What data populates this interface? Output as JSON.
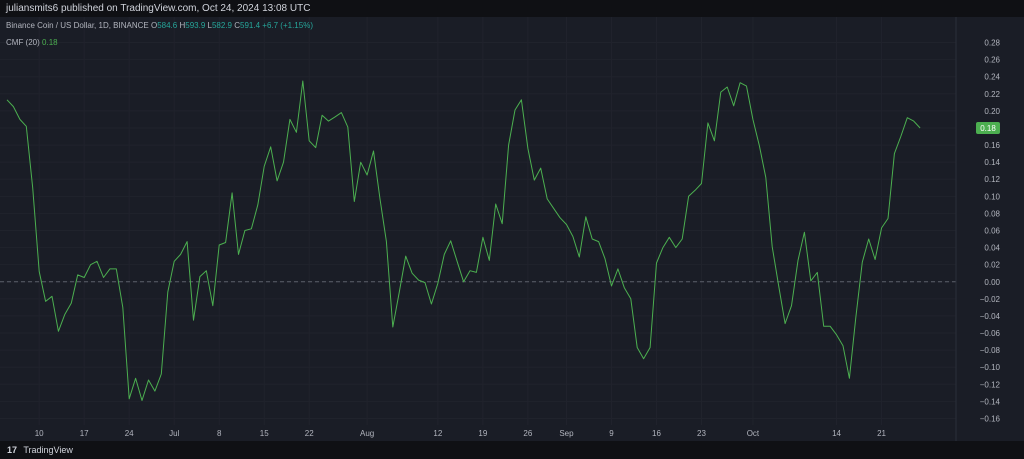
{
  "publish_bar": {
    "text": "juliansmits6 published on TradingView.com, Oct 24, 2024 13:08 UTC"
  },
  "legend": {
    "symbol": "Binance Coin / US Dollar, 1D, BINANCE",
    "open_label": "O",
    "open": "584.6",
    "high_label": "H",
    "high": "593.9",
    "low_label": "L",
    "low": "582.9",
    "close_label": "C",
    "close": "591.4",
    "change": "+6.7 (+1.15%)",
    "indicator": "CMF (20)",
    "indicator_value": "0.18"
  },
  "footer": {
    "logo": "17",
    "brand": "TradingView"
  },
  "colors": {
    "line": "#4caf50",
    "badge": "#4caf50",
    "background": "#1a1d26",
    "grid": "#20232c"
  },
  "chart_data": {
    "type": "line",
    "ylim": [
      -0.17,
      0.29
    ],
    "ytick_labels": [
      "0.28",
      "0.26",
      "0.24",
      "0.22",
      "0.20",
      "0.18",
      "0.16",
      "0.14",
      "0.12",
      "0.10",
      "0.08",
      "0.06",
      "0.04",
      "0.02",
      "0.00",
      "−0.02",
      "−0.04",
      "−0.06",
      "−0.08",
      "−0.10",
      "−0.12",
      "−0.14",
      "−0.16"
    ],
    "yticks": [
      0.28,
      0.26,
      0.24,
      0.22,
      0.2,
      0.18,
      0.16,
      0.14,
      0.12,
      0.1,
      0.08,
      0.06,
      0.04,
      0.02,
      0.0,
      -0.02,
      -0.04,
      -0.06,
      -0.08,
      -0.1,
      -0.12,
      -0.14,
      -0.16
    ],
    "x_range": [
      0,
      144
    ],
    "xticks": [
      {
        "label": "10",
        "x": 5
      },
      {
        "label": "17",
        "x": 12
      },
      {
        "label": "24",
        "x": 19
      },
      {
        "label": "Jul",
        "x": 26
      },
      {
        "label": "8",
        "x": 33
      },
      {
        "label": "15",
        "x": 40
      },
      {
        "label": "22",
        "x": 47
      },
      {
        "label": "Aug",
        "x": 56
      },
      {
        "label": "12",
        "x": 67
      },
      {
        "label": "19",
        "x": 74
      },
      {
        "label": "26",
        "x": 81
      },
      {
        "label": "Sep",
        "x": 87
      },
      {
        "label": "9",
        "x": 94
      },
      {
        "label": "16",
        "x": 101
      },
      {
        "label": "23",
        "x": 108
      },
      {
        "label": "Oct",
        "x": 116
      },
      {
        "label": "14",
        "x": 129
      },
      {
        "label": "21",
        "x": 136
      }
    ],
    "zero_line": 0,
    "last_value_label": "0.18",
    "last_value": 0.18,
    "series": [
      {
        "values": [
          0.213,
          0.205,
          0.19,
          0.182,
          0.11,
          0.012,
          -0.023,
          -0.017,
          -0.058,
          -0.038,
          -0.025,
          0.008,
          0.005,
          0.02,
          0.024,
          0.005,
          0.015,
          0.015,
          -0.03,
          -0.137,
          -0.113,
          -0.139,
          -0.115,
          -0.128,
          -0.108,
          -0.012,
          0.024,
          0.032,
          0.047,
          -0.045,
          0.006,
          0.013,
          -0.028,
          0.043,
          0.046,
          0.104,
          0.032,
          0.06,
          0.062,
          0.09,
          0.135,
          0.158,
          0.118,
          0.14,
          0.19,
          0.175,
          0.235,
          0.165,
          0.157,
          0.195,
          0.188,
          0.193,
          0.198,
          0.181,
          0.094,
          0.14,
          0.125,
          0.153,
          0.097,
          0.047,
          -0.053,
          -0.012,
          0.03,
          0.01,
          0.002,
          -0.001,
          -0.026,
          -0.002,
          0.032,
          0.048,
          0.024,
          0.0,
          0.013,
          0.011,
          0.052,
          0.025,
          0.091,
          0.068,
          0.16,
          0.201,
          0.213,
          0.156,
          0.119,
          0.133,
          0.097,
          0.086,
          0.075,
          0.067,
          0.053,
          0.029,
          0.076,
          0.05,
          0.047,
          0.027,
          -0.005,
          0.015,
          -0.007,
          -0.02,
          -0.077,
          -0.09,
          -0.077,
          0.022,
          0.04,
          0.052,
          0.04,
          0.05,
          0.1,
          0.107,
          0.115,
          0.186,
          0.165,
          0.222,
          0.228,
          0.206,
          0.233,
          0.229,
          0.19,
          0.159,
          0.122,
          0.041,
          -0.005,
          -0.049,
          -0.028,
          0.025,
          0.058,
          0.001,
          0.011,
          -0.052,
          -0.052,
          -0.062,
          -0.075,
          -0.113,
          -0.042,
          0.023,
          0.05,
          0.026,
          0.063,
          0.074,
          0.15,
          0.17,
          0.192,
          0.188,
          0.18
        ]
      }
    ]
  }
}
